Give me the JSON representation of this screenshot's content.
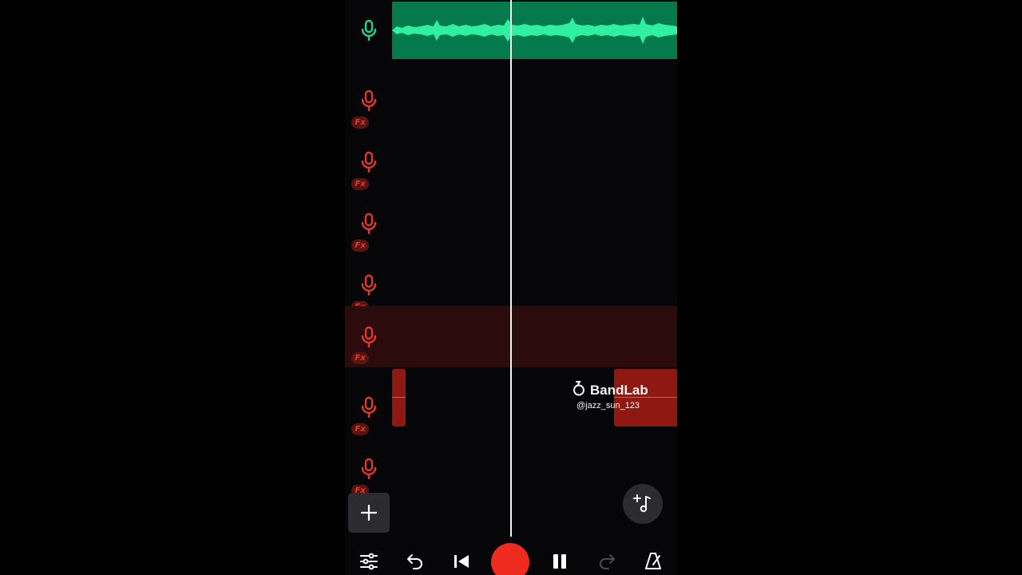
{
  "tracks": [
    {
      "name": "track-1",
      "icon": "microphone-icon",
      "color": "#1fd28d",
      "fx": false,
      "selected": false
    },
    {
      "name": "track-2",
      "icon": "microphone-icon",
      "color": "#e0392b",
      "fx": true,
      "fx_label": "Fx",
      "selected": false
    },
    {
      "name": "track-3",
      "icon": "microphone-icon",
      "color": "#e0392b",
      "fx": true,
      "fx_label": "Fx",
      "selected": false
    },
    {
      "name": "track-4",
      "icon": "microphone-icon",
      "color": "#e0392b",
      "fx": true,
      "fx_label": "Fx",
      "selected": false
    },
    {
      "name": "track-5",
      "icon": "microphone-icon",
      "color": "#e0392b",
      "fx": true,
      "fx_label": "Fx",
      "selected": false
    },
    {
      "name": "track-6",
      "icon": "microphone-icon",
      "color": "#e0392b",
      "fx": true,
      "fx_label": "Fx",
      "selected": true
    },
    {
      "name": "track-7",
      "icon": "microphone-icon",
      "color": "#e0392b",
      "fx": true,
      "fx_label": "Fx",
      "selected": false
    },
    {
      "name": "track-8",
      "icon": "microphone-icon",
      "color": "#e0392b",
      "fx": true,
      "fx_label": "Fx",
      "selected": false
    }
  ],
  "watermark": {
    "brand": "BandLab",
    "handle": "@jazz_sun_123"
  },
  "buttons": {
    "add_track": "plus-icon",
    "add_instrument": "add-music-note-icon"
  },
  "transport": [
    {
      "name": "mixer-button",
      "icon": "sliders-icon"
    },
    {
      "name": "undo-button",
      "icon": "undo-icon"
    },
    {
      "name": "skip-to-start-button",
      "icon": "skip-back-icon"
    },
    {
      "name": "record-button",
      "icon": "record-icon"
    },
    {
      "name": "pause-button",
      "icon": "pause-icon"
    },
    {
      "name": "redo-button",
      "icon": "redo-icon",
      "disabled": true
    },
    {
      "name": "metronome-button",
      "icon": "metronome-icon"
    }
  ],
  "colors": {
    "green_track": "#1fd28d",
    "green_clip": "#047a4c",
    "red_track": "#e0392b",
    "red_clip": "#8f1812",
    "record": "#ef2b1f",
    "selected_row": "#2b0b0b"
  }
}
